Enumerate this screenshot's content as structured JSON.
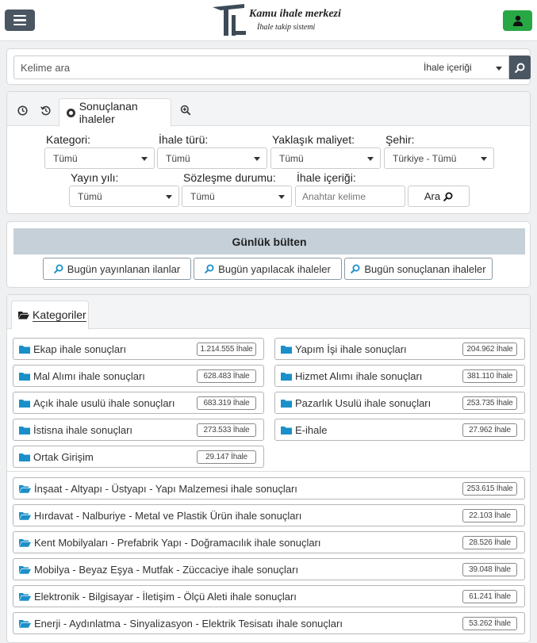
{
  "header": {
    "logo_title": "Kamu ihale merkezi",
    "logo_subtitle": "İhale takip sistemi",
    "menu_icon": "hamburger-icon",
    "user_icon": "user-icon",
    "user_button_color": "#28a745"
  },
  "search": {
    "placeholder": "Kelime ara",
    "value": "",
    "scope_selected": "İhale içeriği",
    "button_icon": "search-icon"
  },
  "filter_tabs": {
    "icons": [
      "clock-icon",
      "history-icon",
      "zoom-in-icon"
    ],
    "active_label": "Sonuçlanan ihaleler"
  },
  "filters": {
    "kategori": {
      "label": "Kategori:",
      "value": "Tümü"
    },
    "ihale_turu": {
      "label": "İhale türü:",
      "value": "Tümü"
    },
    "maliyet": {
      "label": "Yaklaşık maliyet:",
      "value": "Tümü"
    },
    "sehir": {
      "label": "Şehir:",
      "value": "Türkiye - Tümü"
    },
    "yayin_yili": {
      "label": "Yayın yılı:",
      "value": "Tümü"
    },
    "sozlesme": {
      "label": "Sözleşme durumu:",
      "value": "Tümü"
    },
    "icerik": {
      "label": "İhale içeriği:",
      "placeholder": "Anahtar kelime"
    },
    "ara_label": "Ara"
  },
  "bulten": {
    "title": "Günlük bülten",
    "buttons": [
      "Bugün yayınlanan ilanlar",
      "Bugün yapılacak ihaleler",
      "Bugün sonuçlanan ihaleler"
    ]
  },
  "categories": {
    "tab_label": "Kategoriler",
    "left": [
      {
        "label": "Ekap ihale sonuçları",
        "count": "1.214.555 İhale"
      },
      {
        "label": "Mal Alımı ihale sonuçları",
        "count": "628.483 İhale"
      },
      {
        "label": "Açık ihale usulü ihale sonuçları",
        "count": "683.319 İhale"
      },
      {
        "label": "İstisna ihale sonuçları",
        "count": "273.533 İhale"
      },
      {
        "label": "Ortak Girişim",
        "count": "29.147 İhale"
      }
    ],
    "right": [
      {
        "label": "Yapım İşi ihale sonuçları",
        "count": "204.962 İhale"
      },
      {
        "label": "Hizmet Alımı ihale sonuçları",
        "count": "381.110 İhale"
      },
      {
        "label": "Pazarlık Usulü ihale sonuçları",
        "count": "253.735 İhale"
      },
      {
        "label": "E-ihale",
        "count": "27.962 İhale"
      }
    ],
    "sectors": [
      {
        "label": "İnşaat - Altyapı - Üstyapı - Yapı Malzemesi ihale sonuçları",
        "count": "253.615 İhale"
      },
      {
        "label": "Hırdavat - Nalburiye - Metal ve Plastik Ürün ihale sonuçları",
        "count": "22.103 İhale"
      },
      {
        "label": "Kent Mobilyaları - Prefabrik Yapı - Doğramacılık ihale sonuçları",
        "count": "28.526 İhale"
      },
      {
        "label": "Mobilya - Beyaz Eşya - Mutfak - Züccaciye ihale sonuçları",
        "count": "39.048 İhale"
      },
      {
        "label": "Elektronik - Bilgisayar - İletişim - Ölçü Aleti ihale sonuçları",
        "count": "61.241 İhale"
      },
      {
        "label": "Enerji - Aydınlatma - Sinyalizasyon - Elektrik Tesisatı ihale sonuçları",
        "count": "53.262 İhale"
      }
    ],
    "folder_color": "#1a8fc9"
  }
}
